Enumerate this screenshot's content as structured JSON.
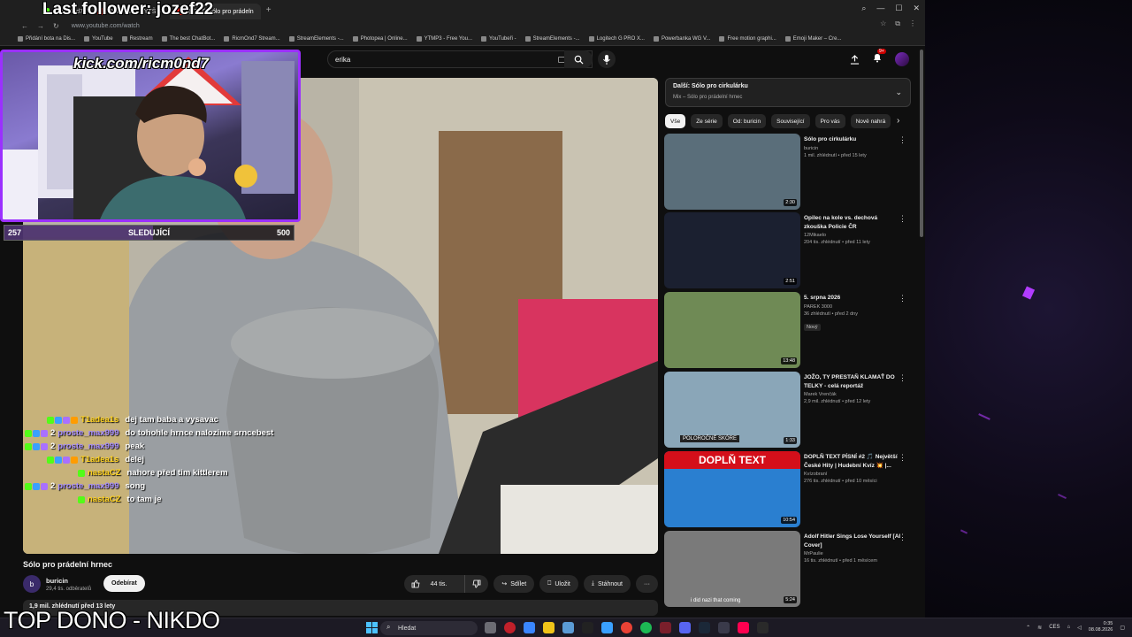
{
  "browser": {
    "tabs": [
      {
        "label": "RicmOnd7"
      },
      {
        "label": "PTK - NECHYTŠ M"
      },
      {
        "label": "(2747) Sólo pro prádeln"
      }
    ],
    "url": "www.youtube.com/watch",
    "bookmarks": [
      "Přidání bota na Dis...",
      "YouTube",
      "Restream",
      "The best ChatBot...",
      "RicmOnd7 Stream...",
      "StreamElements -...",
      "Photopea | Online...",
      "YTMP3 - Free You...",
      "YouTubeři -",
      "StreamElements -...",
      "Logitech G PRO X...",
      "Powerbanka WG V...",
      "Free motion graphi...",
      "Emoji Maker – Cre..."
    ]
  },
  "search": {
    "value": "erika"
  },
  "header": {
    "notif_badge": "9+"
  },
  "video": {
    "title": "Sólo pro prádelní hrnec",
    "channel": "buricin",
    "channel_initial": "b",
    "subscribers": "29,4 tis. odběratelů",
    "subscribe_label": "Odebírat",
    "likes": "44 tis.",
    "share_label": "Sdílet",
    "save_label": "Uložit",
    "download_label": "Stáhnout",
    "more_label": "···",
    "views_date": "1,9 mil. zhlédnutí  před 13 lety"
  },
  "next_up": {
    "title": "Další: Sólo pro cirkulárku",
    "subtitle": "Mix – Sólo pro prádelní hrnec"
  },
  "chips": [
    "Vše",
    "Ze série",
    "Od: buricin",
    "Související",
    "Pro vás",
    "Nově nahrá"
  ],
  "recommendations": [
    {
      "title": "Sólo pro cirkulárku",
      "channel": "buricin",
      "stats": "1 mil. zhlédnutí • před 15 lety",
      "duration": "2:30",
      "thumb": "#5a6e7a",
      "new": ""
    },
    {
      "title": "Opilec na kole vs. dechová zkouška Policie ČR",
      "channel": "12Mikaelo",
      "stats": "204 tis. zhlédnutí • před 11 lety",
      "duration": "2:51",
      "thumb": "#1b2030",
      "new": ""
    },
    {
      "title": "5. srpna 2026",
      "channel": "PAREK 3000",
      "stats": "36 zhlédnutí • před 2 dny",
      "duration": "13:48",
      "thumb": "#6f8a55",
      "new": "Nový"
    },
    {
      "title": "JOŽO, TY PRESTAŇ KLAMAŤ DO TELKY - celá reportáž",
      "channel": "Marek Vrenčák",
      "stats": "2,9 mil. zhlédnutí • před 12 lety",
      "duration": "1:33",
      "thumb": "#8aa6b8",
      "new": ""
    },
    {
      "title": "DOPLŇ TEXT PÍSNÍ #2 🎵 Největší České Hity | Hudební Kvíz 💥 |...",
      "channel": "Kvízobraní",
      "stats": "276 tis. zhlédnutí • před 10 měsíci",
      "duration": "10:54",
      "thumb": "#2a7fd0",
      "new": ""
    },
    {
      "title": "Adolf Hitler Sings Lose Yourself [AI Cover]",
      "channel": "MrPaulie",
      "stats": "16 tis. zhlédnutí • před 1 měsícem",
      "duration": "5:24",
      "thumb": "#7a7a7a",
      "new": ""
    }
  ],
  "thumb_texts": {
    "polorocne": "POLOROČNÉ SKÓRE",
    "doplntext": "DOPLŇ TEXT",
    "hitler": "i did nazi that coming"
  },
  "overlay": {
    "last_follower": "Last follower: jozef22",
    "kick": "kick.com/ricm0nd7",
    "followers_current": "257",
    "followers_label": "SLEDUJÍCÍ",
    "followers_goal": "500",
    "followers_progress": 0.514,
    "bottom_text": "TOP DONO - NIKDO"
  },
  "chat": [
    {
      "user": "T1adea1s",
      "msg": "dej tam baba a vysavac",
      "color": "#ffd21e",
      "badges": [
        "#53fc18",
        "#3aa0ff",
        "#a970ff",
        "#ff9c00"
      ]
    },
    {
      "user": "proste_max999",
      "msg": "do tohohle hrnce nalozime srncebest",
      "color": "#a58cff",
      "badges": [
        "#53fc18",
        "#3aa0ff",
        "#a970ff"
      ],
      "num": "2"
    },
    {
      "user": "proste_max999",
      "msg": "peak",
      "color": "#a58cff",
      "badges": [
        "#53fc18",
        "#3aa0ff",
        "#a970ff"
      ],
      "num": "2"
    },
    {
      "user": "T1adea1s",
      "msg": "delej",
      "color": "#ffd21e",
      "badges": [
        "#53fc18",
        "#3aa0ff",
        "#a970ff",
        "#ff9c00"
      ]
    },
    {
      "user": "nastaCZ",
      "msg": "nahore před tim kittlerem",
      "color": "#ffd21e",
      "badges": [
        "#53fc18"
      ]
    },
    {
      "user": "proste_max999",
      "msg": "song",
      "color": "#a58cff",
      "badges": [
        "#53fc18",
        "#3aa0ff",
        "#a970ff"
      ],
      "num": "2"
    },
    {
      "user": "nastaCZ",
      "msg": "to tam je",
      "color": "#ffd21e",
      "badges": [
        "#53fc18"
      ]
    }
  ],
  "taskbar": {
    "search": "Hledat",
    "lang": "CES",
    "time": "0:35",
    "date": "08.08.2026"
  }
}
